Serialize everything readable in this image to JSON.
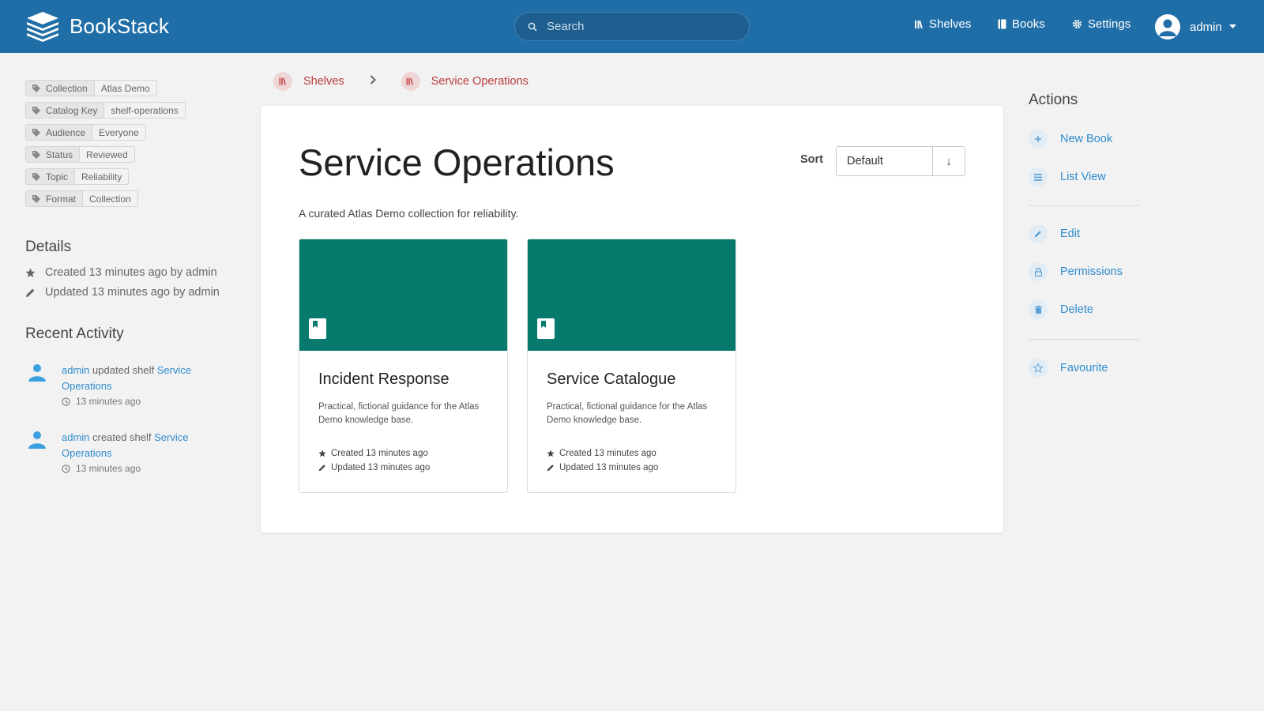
{
  "header": {
    "app_name": "BookStack",
    "search_placeholder": "Search",
    "nav": [
      {
        "label": "Shelves",
        "icon": "shelves-icon"
      },
      {
        "label": "Books",
        "icon": "book-icon"
      },
      {
        "label": "Settings",
        "icon": "gear-icon"
      }
    ],
    "user": {
      "name": "admin"
    },
    "colors": {
      "bar": "#206ea7"
    }
  },
  "tags": [
    {
      "name": "Collection",
      "value": "Atlas Demo"
    },
    {
      "name": "Catalog Key",
      "value": "shelf-operations"
    },
    {
      "name": "Audience",
      "value": "Everyone"
    },
    {
      "name": "Status",
      "value": "Reviewed"
    },
    {
      "name": "Topic",
      "value": "Reliability"
    },
    {
      "name": "Format",
      "value": "Collection"
    }
  ],
  "details": {
    "heading": "Details",
    "created": "Created 13 minutes ago by admin",
    "updated": "Updated 13 minutes ago by admin"
  },
  "recent_activity": {
    "heading": "Recent Activity",
    "items": [
      {
        "user": "admin",
        "action": "updated shelf",
        "target": "Service Operations",
        "time": "13 minutes ago"
      },
      {
        "user": "admin",
        "action": "created shelf",
        "target": "Service Operations",
        "time": "13 minutes ago"
      }
    ]
  },
  "breadcrumb": [
    {
      "label": "Shelves"
    },
    {
      "label": "Service Operations"
    }
  ],
  "shelf": {
    "title": "Service Operations",
    "description": "A curated Atlas Demo collection for reliability.",
    "sort": {
      "label": "Sort",
      "value": "Default",
      "direction": "↓"
    }
  },
  "books": [
    {
      "title": "Incident Response",
      "description": "Practical, fictional guidance for the Atlas Demo knowledge base.",
      "created": "Created 13 minutes ago",
      "updated": "Updated 13 minutes ago",
      "cover_color": "#077a6d"
    },
    {
      "title": "Service Catalogue",
      "description": "Practical, fictional guidance for the Atlas Demo knowledge base.",
      "created": "Created 13 minutes ago",
      "updated": "Updated 13 minutes ago",
      "cover_color": "#077a6d"
    }
  ],
  "actions": {
    "heading": "Actions",
    "items": [
      {
        "label": "New Book",
        "icon": "plus-icon"
      },
      {
        "label": "List View",
        "icon": "list-icon"
      },
      {
        "label": "Edit",
        "icon": "pencil-icon"
      },
      {
        "label": "Permissions",
        "icon": "lock-icon"
      },
      {
        "label": "Delete",
        "icon": "trash-icon"
      },
      {
        "label": "Favourite",
        "icon": "star-icon"
      }
    ]
  }
}
